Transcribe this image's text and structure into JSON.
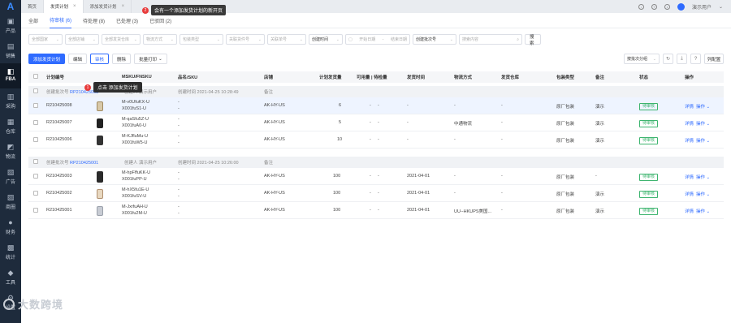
{
  "sidebar": {
    "logo": "A",
    "items": [
      {
        "label": "产品",
        "icon": "box-icon"
      },
      {
        "label": "销售",
        "icon": "chart-icon"
      },
      {
        "label": "FBA",
        "icon": "fba-icon"
      },
      {
        "label": "采购",
        "icon": "cart-icon"
      },
      {
        "label": "仓库",
        "icon": "warehouse-icon"
      },
      {
        "label": "物流",
        "icon": "truck-icon"
      },
      {
        "label": "广告",
        "icon": "ad-icon"
      },
      {
        "label": "商圈",
        "icon": "store-icon"
      },
      {
        "label": "财务",
        "icon": "finance-icon"
      },
      {
        "label": "统计",
        "icon": "stats-icon"
      },
      {
        "label": "工具",
        "icon": "tool-icon"
      },
      {
        "label": "设置",
        "icon": "gear-icon"
      }
    ]
  },
  "topbar": {
    "tabs": [
      {
        "label": "首页"
      },
      {
        "label": "发货计划"
      },
      {
        "label": "添加发货计划"
      }
    ],
    "user": "演示用户"
  },
  "tips": {
    "tip1_num": "2",
    "tip1_text": "会有一个添加发货计划的新开页",
    "tip2_num": "1",
    "tip2_text": "点击 添加发货计划"
  },
  "status_tabs": [
    {
      "label": "全部"
    },
    {
      "label": "待审核 (6)"
    },
    {
      "label": "待处理 (8)"
    },
    {
      "label": "已处理 (3)"
    },
    {
      "label": "已驳回 (2)"
    }
  ],
  "filters": {
    "f1": "全部国家",
    "f2": "全部店铺",
    "f3": "全部发货仓库",
    "f4": "物流方式",
    "f5": "包装类型",
    "f6": "关联货件号",
    "f7": "关联单号",
    "f8": "创建时间",
    "date_start": "开始日期",
    "date_sep": "-",
    "date_end": "结束日期",
    "f9": "创建批次号",
    "search_placeholder": "搜索内容",
    "search_button": "搜索"
  },
  "actions": {
    "add": "添加发货计划",
    "edit": "编辑",
    "audit": "审核",
    "delete": "删除",
    "batch_print": "批量打印",
    "group": "按批次分组"
  },
  "table": {
    "headers": {
      "plan_no": "计划编号",
      "msku": "MSKU/FNSKU",
      "name": "品名/SKU",
      "shop": "店铺",
      "qty": "计划发货量",
      "avail": "可用量 | 待检量",
      "ship_time": "发货时间",
      "logistics": "物流方式",
      "warehouse": "发货仓库",
      "pack": "包装类型",
      "remark": "备注",
      "status": "状态",
      "op": "操作"
    },
    "groups": [
      {
        "batch_label": "创建批次号",
        "batch_no": "RP210425003",
        "creator": "创建人 演示用户",
        "created": "创建时间 2021-04-25 10:28:49",
        "remark": "备注",
        "rows": [
          {
            "plan": "R210425008",
            "msku": "M-v0UfuKX-U",
            "fnsku": "X001fuS1-U",
            "name": "-",
            "sku": "-",
            "shop": "AK-HY-US",
            "qty": "6",
            "avail": "-",
            "check": "-",
            "ship": "-",
            "logistics": "-",
            "warehouse": "-",
            "pack": "原厂包装",
            "remark": "演示",
            "status": "待审核",
            "op1": "详情",
            "op2": "操作"
          },
          {
            "plan": "R210425007",
            "msku": "M-qaSfu5Z-U",
            "fnsku": "X001fuA0-U",
            "name": "-",
            "sku": "-",
            "shop": "AK-HY-US",
            "qty": "5",
            "avail": "-",
            "check": "-",
            "ship": "-",
            "logistics": "中通物流",
            "warehouse": "-",
            "pack": "原厂包装",
            "remark": "演示",
            "status": "待审核",
            "op1": "详情",
            "op2": "操作"
          },
          {
            "plan": "R210425006",
            "msku": "M-KJfluMu-U",
            "fnsku": "X001fuW5-U",
            "name": "-",
            "sku": "-",
            "shop": "AK-HY-US",
            "qty": "10",
            "avail": "-",
            "check": "-",
            "ship": "-",
            "logistics": "-",
            "warehouse": "-",
            "pack": "原厂包装",
            "remark": "演示",
            "status": "待审核",
            "op1": "详情",
            "op2": "操作"
          }
        ]
      },
      {
        "batch_label": "创建批次号",
        "batch_no": "RP210425001",
        "creator": "创建人 演示用户",
        "created": "创建时间 2021-04-25 10:26:00",
        "remark": "备注",
        "rows": [
          {
            "plan": "R210425003",
            "msku": "M-hpFffuKK-U",
            "fnsku": "X001fuPP-U",
            "name": "-",
            "sku": "-",
            "shop": "AK-HY-US",
            "qty": "100",
            "avail": "-",
            "check": "-",
            "ship": "2021-04-01",
            "logistics": "-",
            "warehouse": "-",
            "pack": "原厂包装",
            "remark": "-",
            "status": "待审核",
            "op1": "详情",
            "op2": "操作"
          },
          {
            "plan": "R210425002",
            "msku": "M-hX5fu1E-U",
            "fnsku": "X001fuSV-U",
            "name": "-",
            "sku": "-",
            "shop": "AK-HY-US",
            "qty": "100",
            "avail": "-",
            "check": "-",
            "ship": "2021-04-01",
            "logistics": "-",
            "warehouse": "-",
            "pack": "原厂包装",
            "remark": "演示",
            "status": "待审核",
            "op1": "详情",
            "op2": "操作"
          },
          {
            "plan": "R210425001",
            "msku": "M-JxrfuAH-U",
            "fnsku": "X001fu2M-U",
            "name": "-",
            "sku": "-",
            "shop": "AK-HY-US",
            "qty": "100",
            "avail": "-",
            "check": "-",
            "ship": "2021-04-01",
            "logistics": "UU--HKUPS美国...",
            "warehouse": "-",
            "pack": "原厂包装",
            "remark": "演示",
            "status": "待审核",
            "op1": "详情",
            "op2": "操作"
          }
        ]
      }
    ]
  },
  "watermark": "大数跨境",
  "colors": {
    "accent": "#2f6bff",
    "sidebar": "#1e2b3c",
    "status": "#3cb46e",
    "tip": "#e83b3b"
  }
}
